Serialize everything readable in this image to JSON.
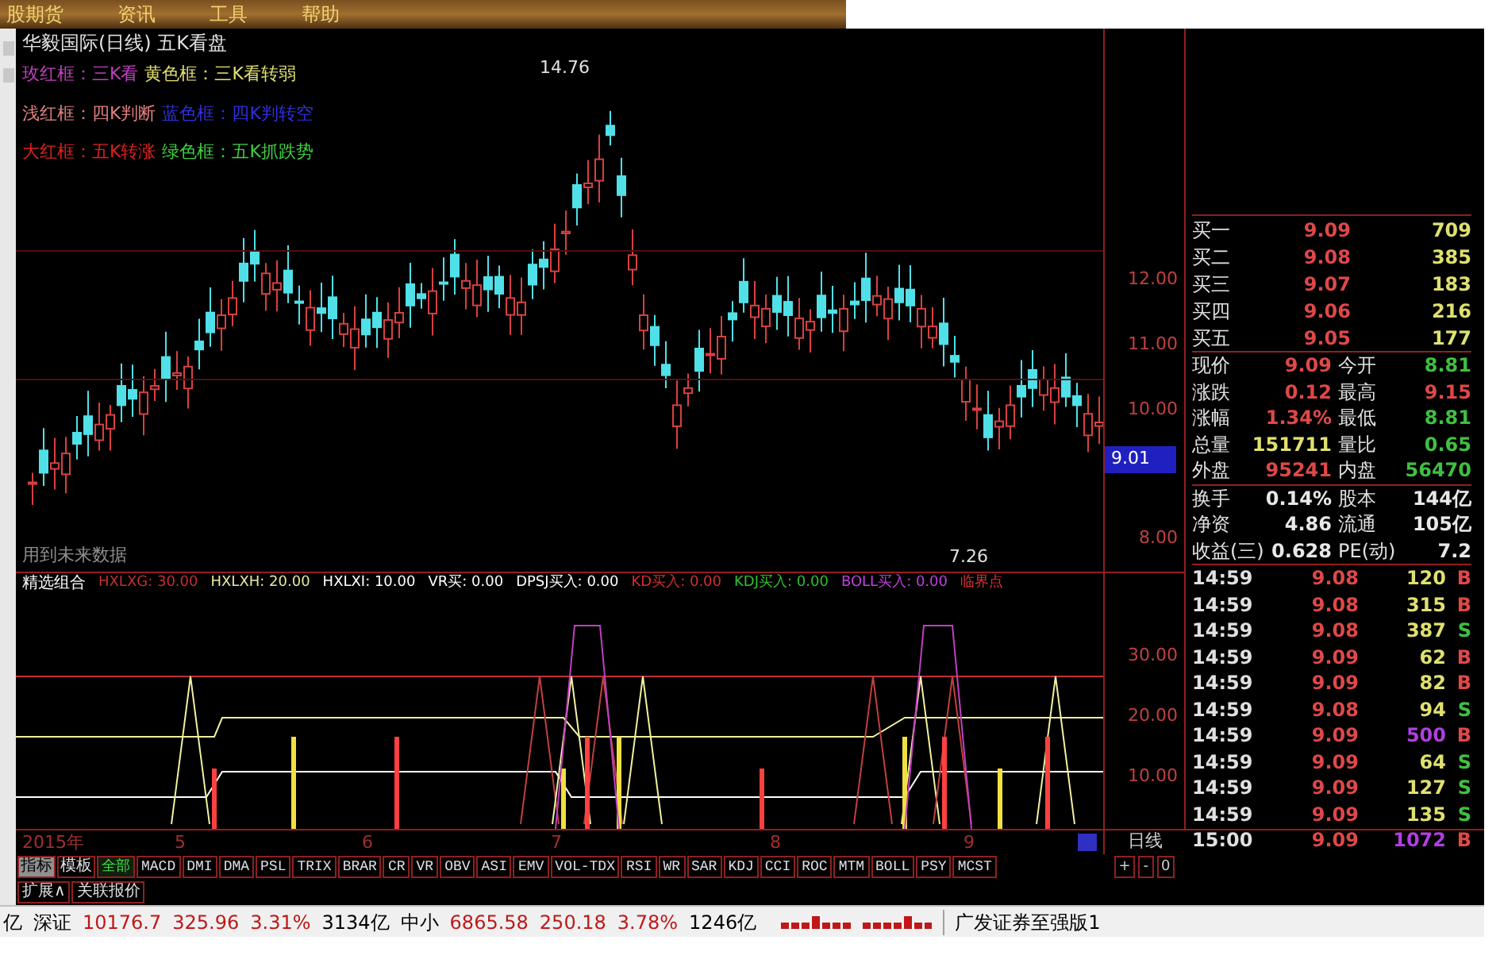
{
  "menu": [
    "股期货",
    "资讯",
    "工具",
    "帮助"
  ],
  "chart": {
    "title": "华毅国际(日线) 五K看盘",
    "legend": [
      [
        {
          "text": "玫红框：三K看",
          "color": "#c040c0"
        },
        {
          "text": "黄色框：三K看转弱",
          "color": "#e0e070"
        }
      ],
      [
        {
          "text": "浅红框：四K判断",
          "color": "#e08080"
        },
        {
          "text": "蓝色框：四K判转空",
          "color": "#3030e0"
        }
      ],
      [
        {
          "text": "大红框：五K转涨",
          "color": "#e02020"
        },
        {
          "text": "绿色框：五K抓跌势",
          "color": "#40d040"
        }
      ]
    ],
    "price_labels": [
      "12.00",
      "11.00",
      "10.00",
      "8.00"
    ],
    "current_price": "9.01",
    "high_mark": "14.76",
    "low_mark": "7.26",
    "note": "用到未来数据"
  },
  "indicator": {
    "name": "精选组合",
    "values": [
      {
        "text": "HXLXG: 30.00",
        "color": "#c03030"
      },
      {
        "text": "HXLXH: 20.00",
        "color": "#e8e8a0"
      },
      {
        "text": "HXLXI: 10.00",
        "color": "#ffffff"
      },
      {
        "text": "VR买: 0.00",
        "color": "#ffffff"
      },
      {
        "text": "DPSJ买入: 0.00",
        "color": "#ffffff"
      },
      {
        "text": "KD买入: 0.00",
        "color": "#d03030"
      },
      {
        "text": "KDJ买入: 0.00",
        "color": "#30c030"
      },
      {
        "text": "BOLL买入: 0.00",
        "color": "#c040e0"
      },
      {
        "text": "临界点",
        "color": "#e03030"
      }
    ],
    "axis_labels": [
      "30.00",
      "20.00",
      "10.00"
    ]
  },
  "date_axis": {
    "year": "2015年",
    "months": [
      "5",
      "6",
      "7",
      "8",
      "9"
    ],
    "period": "日线",
    "zoom_controls": [
      "+",
      "-",
      "0"
    ]
  },
  "mode_tabs": [
    {
      "label": "指标",
      "selected": true
    },
    {
      "label": "模板",
      "selected": false
    }
  ],
  "indicator_tabs": [
    {
      "label": "全部",
      "selected": true
    },
    {
      "label": "MACD",
      "selected": false
    },
    {
      "label": "DMI",
      "selected": false
    },
    {
      "label": "DMA",
      "selected": false
    },
    {
      "label": "PSL",
      "selected": false
    },
    {
      "label": "TRIX",
      "selected": false
    },
    {
      "label": "BRAR",
      "selected": false
    },
    {
      "label": "CR",
      "selected": false
    },
    {
      "label": "VR",
      "selected": false
    },
    {
      "label": "OBV",
      "selected": false
    },
    {
      "label": "ASI",
      "selected": false
    },
    {
      "label": "EMV",
      "selected": false
    },
    {
      "label": "VOL-TDX",
      "selected": false
    },
    {
      "label": "RSI",
      "selected": false
    },
    {
      "label": "WR",
      "selected": false
    },
    {
      "label": "SAR",
      "selected": false
    },
    {
      "label": "KDJ",
      "selected": false
    },
    {
      "label": "CCI",
      "selected": false
    },
    {
      "label": "ROC",
      "selected": false
    },
    {
      "label": "MTM",
      "selected": false
    },
    {
      "label": "BOLL",
      "selected": false
    },
    {
      "label": "PSY",
      "selected": false
    },
    {
      "label": "MCST",
      "selected": false
    }
  ],
  "extra_tabs": [
    "扩展∧",
    "关联报价"
  ],
  "quote": {
    "bids": [
      {
        "label": "买一",
        "price": "9.09",
        "volume": "709"
      },
      {
        "label": "买二",
        "price": "9.08",
        "volume": "385"
      },
      {
        "label": "买三",
        "price": "9.07",
        "volume": "183"
      },
      {
        "label": "买四",
        "price": "9.06",
        "volume": "216"
      },
      {
        "label": "买五",
        "price": "9.05",
        "volume": "177"
      }
    ],
    "stat_groups": [
      [
        [
          {
            "label": "现价",
            "value": "9.09",
            "color": "#e04848"
          },
          {
            "label": "今开",
            "value": "8.81",
            "color": "#40c040"
          }
        ],
        [
          {
            "label": "涨跌",
            "value": "0.12",
            "color": "#e04848"
          },
          {
            "label": "最高",
            "value": "9.15",
            "color": "#e04848"
          }
        ],
        [
          {
            "label": "涨幅",
            "value": "1.34%",
            "color": "#e04848"
          },
          {
            "label": "最低",
            "value": "8.81",
            "color": "#40c040"
          }
        ],
        [
          {
            "label": "总量",
            "value": "151711",
            "color": "#e0e070"
          },
          {
            "label": "量比",
            "value": "0.65",
            "color": "#40c040"
          }
        ],
        [
          {
            "label": "外盘",
            "value": "95241",
            "color": "#e04848"
          },
          {
            "label": "内盘",
            "value": "56470",
            "color": "#40c040"
          }
        ]
      ],
      [
        [
          {
            "label": "换手",
            "value": "0.14%",
            "color": "#e8e8e8"
          },
          {
            "label": "股本",
            "value": "144亿",
            "color": "#e8e8e8"
          }
        ],
        [
          {
            "label": "净资",
            "value": "4.86",
            "color": "#e8e8e8"
          },
          {
            "label": "流通",
            "value": "105亿",
            "color": "#e8e8e8"
          }
        ],
        [
          {
            "label": "收益(三)",
            "value": "0.628",
            "color": "#e8e8e8"
          },
          {
            "label": "PE(动)",
            "value": "7.2",
            "color": "#e8e8e8"
          }
        ]
      ]
    ]
  },
  "trades": [
    {
      "time": "14:59",
      "price": "9.08",
      "volume": {
        "text": "120",
        "color": "#e0e070"
      },
      "side": {
        "text": "B",
        "color": "#e04848"
      }
    },
    {
      "time": "14:59",
      "price": "9.08",
      "volume": {
        "text": "315",
        "color": "#e0e070"
      },
      "side": {
        "text": "B",
        "color": "#e04848"
      }
    },
    {
      "time": "14:59",
      "price": "9.08",
      "volume": {
        "text": "387",
        "color": "#e0e070"
      },
      "side": {
        "text": "S",
        "color": "#40c040"
      }
    },
    {
      "time": "14:59",
      "price": "9.09",
      "volume": {
        "text": "62",
        "color": "#e0e070"
      },
      "side": {
        "text": "B",
        "color": "#e04848"
      }
    },
    {
      "time": "14:59",
      "price": "9.09",
      "volume": {
        "text": "82",
        "color": "#e0e070"
      },
      "side": {
        "text": "B",
        "color": "#e04848"
      }
    },
    {
      "time": "14:59",
      "price": "9.08",
      "volume": {
        "text": "94",
        "color": "#e0e070"
      },
      "side": {
        "text": "S",
        "color": "#40c040"
      }
    },
    {
      "time": "14:59",
      "price": "9.09",
      "volume": {
        "text": "500",
        "color": "#b040e0"
      },
      "side": {
        "text": "B",
        "color": "#e04848"
      }
    },
    {
      "time": "14:59",
      "price": "9.09",
      "volume": {
        "text": "64",
        "color": "#e0e070"
      },
      "side": {
        "text": "S",
        "color": "#40c040"
      }
    },
    {
      "time": "14:59",
      "price": "9.09",
      "volume": {
        "text": "127",
        "color": "#e0e070"
      },
      "side": {
        "text": "S",
        "color": "#40c040"
      }
    },
    {
      "time": "14:59",
      "price": "9.09",
      "volume": {
        "text": "135",
        "color": "#e0e070"
      },
      "side": {
        "text": "S",
        "color": "#40c040"
      }
    },
    {
      "time": "15:00",
      "price": "9.09",
      "volume": {
        "text": "1072",
        "color": "#b040e0"
      },
      "side": {
        "text": "B",
        "color": "#e04848"
      }
    }
  ],
  "status_bar": {
    "items": [
      {
        "text": "亿",
        "color": "#000000"
      },
      {
        "text": "深证",
        "color": "#000000"
      },
      {
        "text": "10176.7",
        "color": "#c01818"
      },
      {
        "text": "325.96",
        "color": "#c01818"
      },
      {
        "text": "3.31%",
        "color": "#c01818"
      },
      {
        "text": "3134亿",
        "color": "#000000"
      },
      {
        "text": "中小",
        "color": "#000000"
      },
      {
        "text": "6865.58",
        "color": "#c01818"
      },
      {
        "text": "250.18",
        "color": "#c01818"
      },
      {
        "text": "3.78%",
        "color": "#c01818"
      },
      {
        "text": "1246亿",
        "color": "#000000"
      }
    ],
    "broker": "广发证券至强版1"
  }
}
